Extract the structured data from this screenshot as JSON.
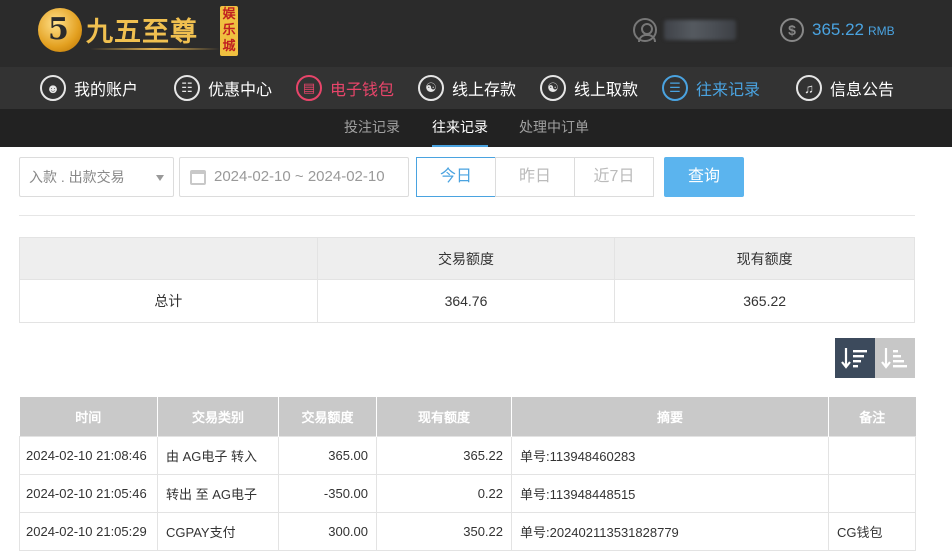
{
  "header": {
    "logo_mark": "5",
    "logo_text": "九五至尊",
    "logo_badge": "娱乐城",
    "balance": "365.22",
    "balance_unit": "RMB",
    "balance_icon": "dollar-icon"
  },
  "nav": [
    {
      "label": "我的账户",
      "icon": "user-icon",
      "state": "default"
    },
    {
      "label": "优惠中心",
      "icon": "gift-icon",
      "state": "default"
    },
    {
      "label": "电子钱包",
      "icon": "wallet-icon",
      "state": "highlight"
    },
    {
      "label": "线上存款",
      "icon": "deposit-icon",
      "state": "default"
    },
    {
      "label": "线上取款",
      "icon": "withdraw-icon",
      "state": "default"
    },
    {
      "label": "往来记录",
      "icon": "records-icon",
      "state": "active"
    },
    {
      "label": "信息公告",
      "icon": "bell-icon",
      "state": "default"
    }
  ],
  "subnav": [
    {
      "label": "投注记录"
    },
    {
      "label": "往来记录",
      "active": true
    },
    {
      "label": "处理中订单"
    }
  ],
  "filters": {
    "type_value": "入款 . 出款交易",
    "date_range": "2024-02-10 ~ 2024-02-10",
    "days": [
      "今日",
      "昨日",
      "近7日"
    ],
    "active_day": "今日",
    "query_label": "查询"
  },
  "summary": {
    "headers": [
      "",
      "交易额度",
      "现有额度"
    ],
    "row": [
      "总计",
      "364.76",
      "365.22"
    ]
  },
  "transactions": {
    "headers": [
      "时间",
      "交易类别",
      "交易额度",
      "现有额度",
      "摘要",
      "备注"
    ],
    "rows": [
      [
        "2024-02-10 21:08:46",
        "由 AG电子 转入",
        "365.00",
        "365.22",
        "单号:113948460283",
        ""
      ],
      [
        "2024-02-10 21:05:46",
        "转出 至 AG电子",
        "-350.00",
        "0.22",
        "单号:113948448515",
        ""
      ],
      [
        "2024-02-10 21:05:29",
        "CGPAY支付",
        "300.00",
        "350.22",
        "单号:202402113531828779",
        "CG钱包"
      ]
    ]
  },
  "colors": {
    "accent": "#4aa3e0",
    "highlight": "#e8456a",
    "header_bg": "#2b2b2b",
    "table_head": "#c9c9c9"
  }
}
